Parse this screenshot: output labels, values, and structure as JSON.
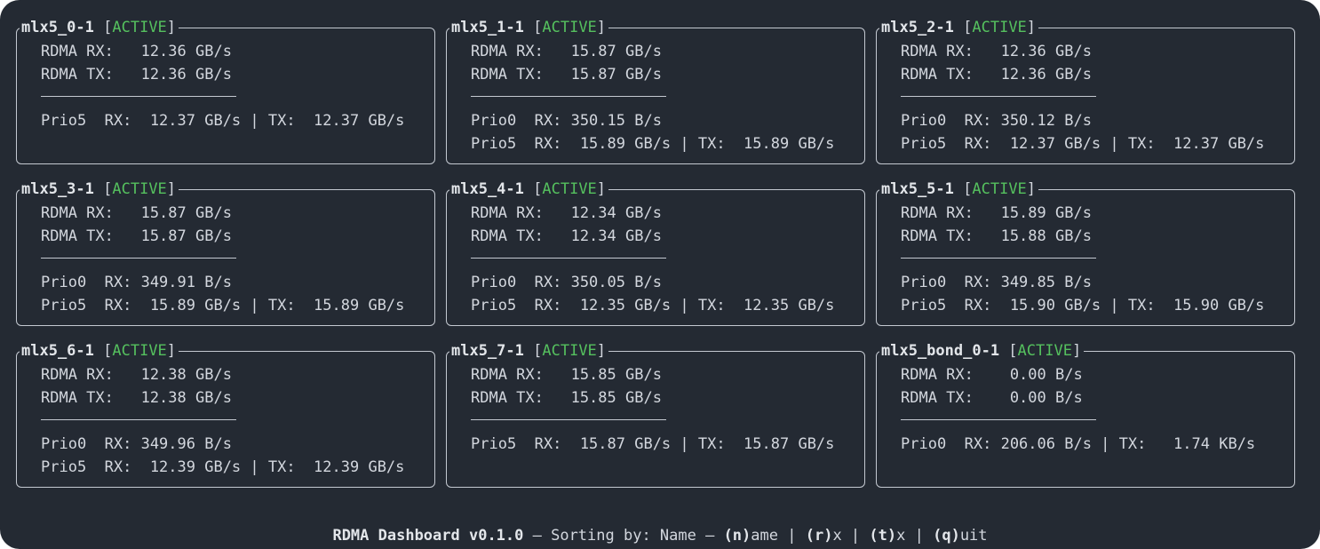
{
  "dashboard": {
    "devices": [
      {
        "name": "mlx5_0-1",
        "state": "ACTIVE",
        "rdma_rx": "RDMA RX:   12.36 GB/s",
        "rdma_tx": "RDMA TX:   12.36 GB/s",
        "prio_lines": [
          "Prio5  RX:  12.37 GB/s | TX:  12.37 GB/s"
        ]
      },
      {
        "name": "mlx5_1-1",
        "state": "ACTIVE",
        "rdma_rx": "RDMA RX:   15.87 GB/s",
        "rdma_tx": "RDMA TX:   15.87 GB/s",
        "prio_lines": [
          "Prio0  RX: 350.15 B/s",
          "Prio5  RX:  15.89 GB/s | TX:  15.89 GB/s"
        ]
      },
      {
        "name": "mlx5_2-1",
        "state": "ACTIVE",
        "rdma_rx": "RDMA RX:   12.36 GB/s",
        "rdma_tx": "RDMA TX:   12.36 GB/s",
        "prio_lines": [
          "Prio0  RX: 350.12 B/s",
          "Prio5  RX:  12.37 GB/s | TX:  12.37 GB/s"
        ]
      },
      {
        "name": "mlx5_3-1",
        "state": "ACTIVE",
        "rdma_rx": "RDMA RX:   15.87 GB/s",
        "rdma_tx": "RDMA TX:   15.87 GB/s",
        "prio_lines": [
          "Prio0  RX: 349.91 B/s",
          "Prio5  RX:  15.89 GB/s | TX:  15.89 GB/s"
        ]
      },
      {
        "name": "mlx5_4-1",
        "state": "ACTIVE",
        "rdma_rx": "RDMA RX:   12.34 GB/s",
        "rdma_tx": "RDMA TX:   12.34 GB/s",
        "prio_lines": [
          "Prio0  RX: 350.05 B/s",
          "Prio5  RX:  12.35 GB/s | TX:  12.35 GB/s"
        ]
      },
      {
        "name": "mlx5_5-1",
        "state": "ACTIVE",
        "rdma_rx": "RDMA RX:   15.89 GB/s",
        "rdma_tx": "RDMA TX:   15.88 GB/s",
        "prio_lines": [
          "Prio0  RX: 349.85 B/s",
          "Prio5  RX:  15.90 GB/s | TX:  15.90 GB/s"
        ]
      },
      {
        "name": "mlx5_6-1",
        "state": "ACTIVE",
        "rdma_rx": "RDMA RX:   12.38 GB/s",
        "rdma_tx": "RDMA TX:   12.38 GB/s",
        "prio_lines": [
          "Prio0  RX: 349.96 B/s",
          "Prio5  RX:  12.39 GB/s | TX:  12.39 GB/s"
        ]
      },
      {
        "name": "mlx5_7-1",
        "state": "ACTIVE",
        "rdma_rx": "RDMA RX:   15.85 GB/s",
        "rdma_tx": "RDMA TX:   15.85 GB/s",
        "prio_lines": [
          "Prio5  RX:  15.87 GB/s | TX:  15.87 GB/s"
        ]
      },
      {
        "name": "mlx5_bond_0-1",
        "state": "ACTIVE",
        "rdma_rx": "RDMA RX:    0.00 B/s",
        "rdma_tx": "RDMA TX:    0.00 B/s",
        "prio_lines": [
          "Prio0  RX: 206.06 B/s | TX:   1.74 KB/s"
        ]
      }
    ],
    "footer": {
      "title": "RDMA Dashboard v0.1.0",
      "sep1": " – Sorting by: Name – ",
      "key_name": "(n)",
      "label_name": "ame",
      "sep2": " | ",
      "key_rx": "(r)",
      "label_rx": "x",
      "sep3": " | ",
      "key_tx": "(t)",
      "label_tx": "x",
      "sep4": " | ",
      "key_quit": "(q)",
      "label_quit": "uit"
    },
    "colors": {
      "background": "#242a33",
      "text": "#d3d7de",
      "active": "#55c05e",
      "border": "#c4c9d1"
    }
  }
}
